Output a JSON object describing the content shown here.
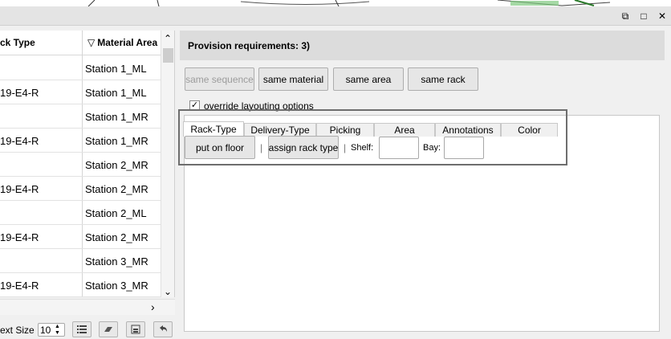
{
  "window_controls": {
    "float": "⧉",
    "maximize": "□",
    "close": "✕"
  },
  "table": {
    "headers": {
      "rack_type": "ck Type",
      "material_area": "Material Area",
      "sort_arrow": "▽"
    },
    "rows": [
      {
        "rack_type": "",
        "material_area": "Station 1_ML"
      },
      {
        "rack_type": "19-E4-R",
        "material_area": "Station 1_ML"
      },
      {
        "rack_type": "",
        "material_area": "Station 1_MR"
      },
      {
        "rack_type": "19-E4-R",
        "material_area": "Station 1_MR"
      },
      {
        "rack_type": "",
        "material_area": "Station 2_MR"
      },
      {
        "rack_type": "19-E4-R",
        "material_area": "Station 2_MR"
      },
      {
        "rack_type": "",
        "material_area": "Station 2_ML"
      },
      {
        "rack_type": "19-E4-R",
        "material_area": "Station 2_MR"
      },
      {
        "rack_type": "",
        "material_area": "Station 3_MR"
      },
      {
        "rack_type": "19-E4-R",
        "material_area": "Station 3_MR"
      }
    ],
    "scroll_up": "⌃",
    "scroll_down": "⌄",
    "scroll_right": "›"
  },
  "bottom_bar": {
    "text_size_label": "ext Size",
    "text_size_value": "10"
  },
  "provision": {
    "title": "Provision requirements: 3)",
    "buttons": {
      "same_sequence": "same sequence",
      "same_material": "same material",
      "same_area": "same area",
      "same_rack": "same rack"
    },
    "override_label": "override layouting options",
    "override_checked": "✓",
    "tabs": [
      "Rack-Type",
      "Delivery-Type",
      "Picking",
      "Area",
      "Annotations",
      "Color"
    ],
    "active_tab": "Rack-Type",
    "rack_type_tab": {
      "put_on_floor": "put on floor",
      "separator": "|",
      "assign_rack_type": "assign rack type",
      "shelf_label": "Shelf:",
      "bay_label": "Bay:",
      "shelf_value": "",
      "bay_value": ""
    }
  }
}
